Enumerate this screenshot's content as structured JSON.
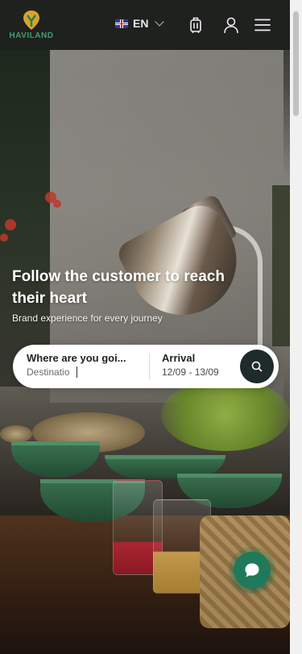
{
  "header": {
    "logo_text": "HAVILAND",
    "language": {
      "code": "EN",
      "flag_icon": "uk-flag-icon"
    },
    "icons": [
      "luggage-icon",
      "user-icon",
      "menu-icon"
    ]
  },
  "hero": {
    "headline": "Follow the customer to reach their heart",
    "subline": "Brand experience for every journey"
  },
  "search": {
    "destination_label": "Where are you goi...",
    "destination_placeholder": "Destinatio",
    "arrival_label": "Arrival",
    "arrival_value": "12/09 - 13/09"
  },
  "colors": {
    "brand_green": "#3fa06a",
    "header_bg": "#1f211f",
    "search_button": "#1f2b2a",
    "chat_button": "#1f7a5a"
  }
}
